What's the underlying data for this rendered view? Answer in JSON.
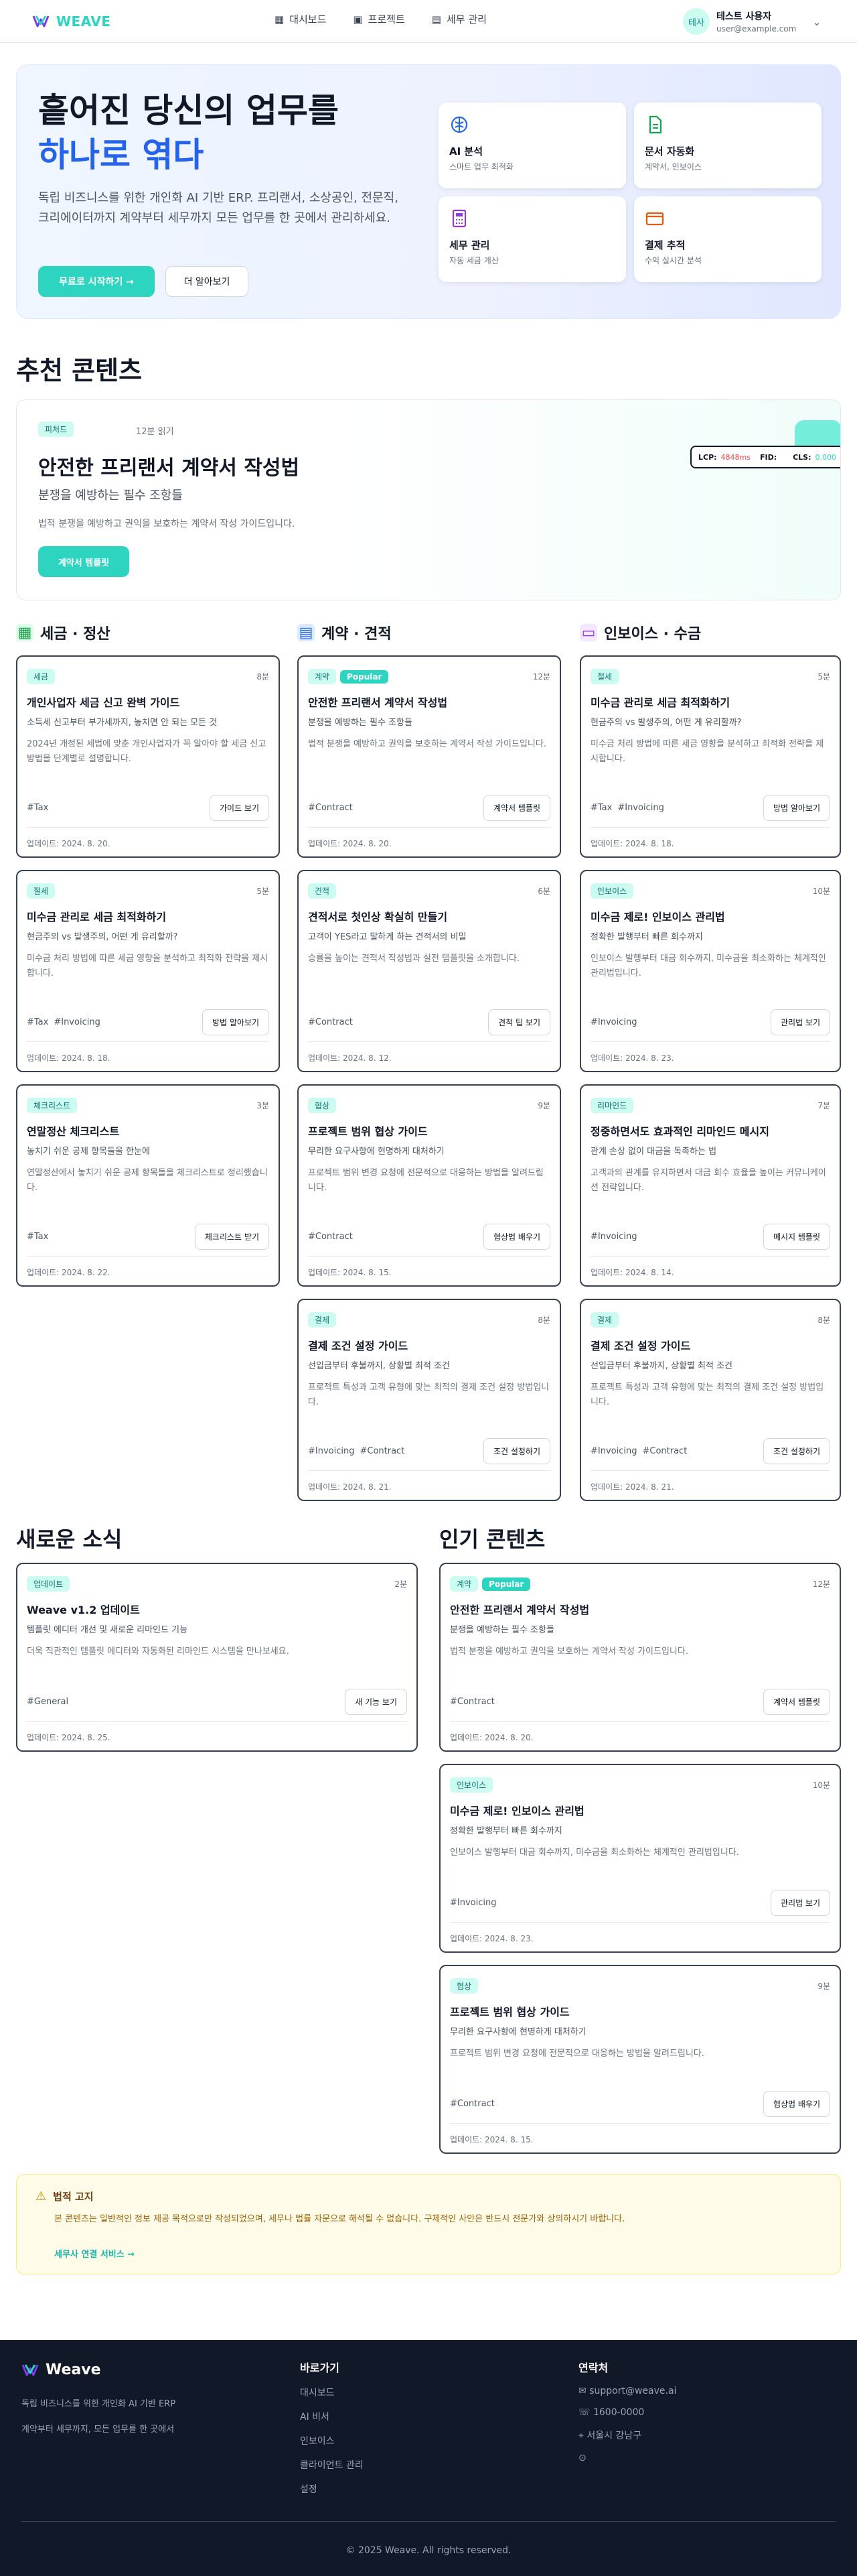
{
  "nav": {
    "brand": "WEAVE",
    "links": [
      "대시보드",
      "프로젝트",
      "세무 관리"
    ],
    "avatar": "테사",
    "user_name": "테스트 사용자",
    "user_email": "user@example.com"
  },
  "hero": {
    "title_line1": "흩어진 당신의 업무를",
    "title_line2": "하나로 엮다",
    "desc": "독립 비즈니스를 위한 개인화 AI 기반 ERP. 프리랜서, 소상공인, 전문직, 크리에이터까지 계약부터 세무까지 모든 업무를 한 곳에서 관리하세요.",
    "cta_primary": "무료로 시작하기 →",
    "cta_secondary": "더 알아보기",
    "features": [
      {
        "title": "AI 분석",
        "desc": "스마트 업무 최적화",
        "icon": "brain-icon",
        "color": "#2563eb"
      },
      {
        "title": "문서 자동화",
        "desc": "계약서, 인보이스",
        "icon": "document-icon",
        "color": "#16a34a"
      },
      {
        "title": "세무 관리",
        "desc": "자동 세금 계산",
        "icon": "calculator-icon",
        "color": "#9333ea"
      },
      {
        "title": "결제 추적",
        "desc": "수익 실시간 분석",
        "icon": "card-icon",
        "color": "#ea580c"
      }
    ]
  },
  "recommended": {
    "title": "추천 콘텐츠",
    "featured": {
      "badge": "피처드",
      "read": "12분 읽기",
      "title": "안전한 프리랜서 계약서 작성법",
      "subtitle": "분쟁을 예방하는 필수 조항들",
      "desc": "법적 분쟁을 예방하고 권익을 보호하는 계약서 작성 가이드입니다.",
      "button": "계약서 템플릿"
    },
    "perf": {
      "lcp_label": "LCP:",
      "lcp_value": "4848ms",
      "fid_label": "FID:",
      "fid_value": "",
      "cls_label": "CLS:",
      "cls_value": "0.000"
    }
  },
  "columns": [
    {
      "title": "세금 · 정산",
      "icon": "calculator-icon",
      "color": "#16a34a",
      "bg": "#dcfce7",
      "cards": [
        {
          "badge": "세금",
          "read": "8분",
          "title": "개인사업자 세금 신고 완벽 가이드",
          "subtitle": "소득세 신고부터 부가세까지, 놓치면 안 되는 모든 것",
          "desc": "2024년 개정된 세법에 맞춘 개인사업자가 꼭 알아야 할 세금 신고 방법을 단계별로 설명합니다.",
          "tags": [
            "#Tax"
          ],
          "button": "가이드 보기",
          "updated": "업데이트: 2024. 8. 20."
        },
        {
          "badge": "절세",
          "read": "5분",
          "title": "미수금 관리로 세금 최적화하기",
          "subtitle": "현금주의 vs 발생주의, 어떤 게 유리할까?",
          "desc": "미수금 처리 방법에 따른 세금 영향을 분석하고 최적화 전략을 제시합니다.",
          "tags": [
            "#Tax",
            "#Invoicing"
          ],
          "button": "방법 알아보기",
          "updated": "업데이트: 2024. 8. 18."
        },
        {
          "badge": "체크리스트",
          "read": "3분",
          "title": "연말정산 체크리스트",
          "subtitle": "놓치기 쉬운 공제 항목들을 한눈에",
          "desc": "연말정산에서 놓치기 쉬운 공제 항목들을 체크리스트로 정리했습니다.",
          "tags": [
            "#Tax"
          ],
          "button": "체크리스트 받기",
          "updated": "업데이트: 2024. 8. 22."
        }
      ]
    },
    {
      "title": "계약 · 견적",
      "icon": "document-icon",
      "color": "#2563eb",
      "bg": "#dbeafe",
      "cards": [
        {
          "badge": "계약",
          "popular": "Popular",
          "read": "12분",
          "title": "안전한 프리랜서 계약서 작성법",
          "subtitle": "분쟁을 예방하는 필수 조항들",
          "desc": "법적 분쟁을 예방하고 권익을 보호하는 계약서 작성 가이드입니다.",
          "tags": [
            "#Contract"
          ],
          "button": "계약서 템플릿",
          "updated": "업데이트: 2024. 8. 20."
        },
        {
          "badge": "견적",
          "read": "6분",
          "title": "견적서로 첫인상 확실히 만들기",
          "subtitle": "고객이 YES라고 말하게 하는 견적서의 비밀",
          "desc": "승률을 높이는 견적서 작성법과 실전 템플릿을 소개합니다.",
          "tags": [
            "#Contract"
          ],
          "button": "견적 팁 보기",
          "updated": "업데이트: 2024. 8. 12."
        },
        {
          "badge": "협상",
          "read": "9분",
          "title": "프로젝트 범위 협상 가이드",
          "subtitle": "무리한 요구사항에 현명하게 대처하기",
          "desc": "프로젝트 범위 변경 요청에 전문적으로 대응하는 방법을 알려드립니다.",
          "tags": [
            "#Contract"
          ],
          "button": "협상법 배우기",
          "updated": "업데이트: 2024. 8. 15."
        },
        {
          "badge": "결제",
          "read": "8분",
          "title": "결제 조건 설정 가이드",
          "subtitle": "선입금부터 후불까지, 상황별 최적 조건",
          "desc": "프로젝트 특성과 고객 유형에 맞는 최적의 결제 조건 설정 방법입니다.",
          "tags": [
            "#Invoicing",
            "#Contract"
          ],
          "button": "조건 설정하기",
          "updated": "업데이트: 2024. 8. 21."
        }
      ]
    },
    {
      "title": "인보이스 · 수금",
      "icon": "card-icon",
      "color": "#9333ea",
      "bg": "#f3e8ff",
      "cards": [
        {
          "badge": "절세",
          "read": "5분",
          "title": "미수금 관리로 세금 최적화하기",
          "subtitle": "현금주의 vs 발생주의, 어떤 게 유리할까?",
          "desc": "미수금 처리 방법에 따른 세금 영향을 분석하고 최적화 전략을 제시합니다.",
          "tags": [
            "#Tax",
            "#Invoicing"
          ],
          "button": "방법 알아보기",
          "updated": "업데이트: 2024. 8. 18."
        },
        {
          "badge": "인보이스",
          "read": "10분",
          "title": "미수금 제로! 인보이스 관리법",
          "subtitle": "정확한 발행부터 빠른 회수까지",
          "desc": "인보이스 발행부터 대금 회수까지, 미수금을 최소화하는 체계적인 관리법입니다.",
          "tags": [
            "#Invoicing"
          ],
          "button": "관리법 보기",
          "updated": "업데이트: 2024. 8. 23."
        },
        {
          "badge": "리마인드",
          "read": "7분",
          "title": "정중하면서도 효과적인 리마인드 메시지",
          "subtitle": "관계 손상 없이 대금을 독촉하는 법",
          "desc": "고객과의 관계를 유지하면서 대금 회수 효율을 높이는 커뮤니케이션 전략입니다.",
          "tags": [
            "#Invoicing"
          ],
          "button": "메시지 템플릿",
          "updated": "업데이트: 2024. 8. 14."
        },
        {
          "badge": "결제",
          "read": "8분",
          "title": "결제 조건 설정 가이드",
          "subtitle": "선입금부터 후불까지, 상황별 최적 조건",
          "desc": "프로젝트 특성과 고객 유형에 맞는 최적의 결제 조건 설정 방법입니다.",
          "tags": [
            "#Invoicing",
            "#Contract"
          ],
          "button": "조건 설정하기",
          "updated": "업데이트: 2024. 8. 21."
        }
      ]
    }
  ],
  "news": {
    "title": "새로운 소식",
    "cards": [
      {
        "badge": "업데이트",
        "read": "2분",
        "title": "Weave v1.2 업데이트",
        "subtitle": "템플릿 에디터 개선 및 새로운 리마인드 기능",
        "desc": "더욱 직관적인 템플릿 에디터와 자동화된 리마인드 시스템을 만나보세요.",
        "tags": [
          "#General"
        ],
        "button": "새 기능 보기",
        "updated": "업데이트: 2024. 8. 25."
      }
    ]
  },
  "popular": {
    "title": "인기 콘텐츠",
    "cards": [
      {
        "badge": "계약",
        "popular": "Popular",
        "read": "12분",
        "title": "안전한 프리랜서 계약서 작성법",
        "subtitle": "분쟁을 예방하는 필수 조항들",
        "desc": "법적 분쟁을 예방하고 권익을 보호하는 계약서 작성 가이드입니다.",
        "tags": [
          "#Contract"
        ],
        "button": "계약서 템플릿",
        "updated": "업데이트: 2024. 8. 20."
      },
      {
        "badge": "인보이스",
        "read": "10분",
        "title": "미수금 제로! 인보이스 관리법",
        "subtitle": "정확한 발행부터 빠른 회수까지",
        "desc": "인보이스 발행부터 대금 회수까지, 미수금을 최소화하는 체계적인 관리법입니다.",
        "tags": [
          "#Invoicing"
        ],
        "button": "관리법 보기",
        "updated": "업데이트: 2024. 8. 23."
      },
      {
        "badge": "협상",
        "read": "9분",
        "title": "프로젝트 범위 협상 가이드",
        "subtitle": "무리한 요구사항에 현명하게 대처하기",
        "desc": "프로젝트 범위 변경 요청에 전문적으로 대응하는 방법을 알려드립니다.",
        "tags": [
          "#Contract"
        ],
        "button": "협상법 배우기",
        "updated": "업데이트: 2024. 8. 15."
      }
    ]
  },
  "legal": {
    "title": "법적 고지",
    "text": "본 콘텐츠는 일반적인 정보 제공 목적으로만 작성되었으며, 세무나 법률 자문으로 해석될 수 없습니다. 구체적인 사안은 반드시 전문가와 상의하시기 바랍니다.",
    "link": "세무사 연결 서비스 →"
  },
  "footer": {
    "brand": "Weave",
    "tagline1": "독립 비즈니스를 위한 개인화 AI 기반 ERP",
    "tagline2": "계약부터 세무까지, 모든 업무를 한 곳에서",
    "links_title": "바로가기",
    "links": [
      "대시보드",
      "AI 비서",
      "인보이스",
      "클라이언트 관리",
      "설정"
    ],
    "contact_title": "연락처",
    "email": "support@weave.ai",
    "phone": "1600-0000",
    "address": "서울시 강남구",
    "copyright": "© 2025 Weave. All rights reserved."
  }
}
